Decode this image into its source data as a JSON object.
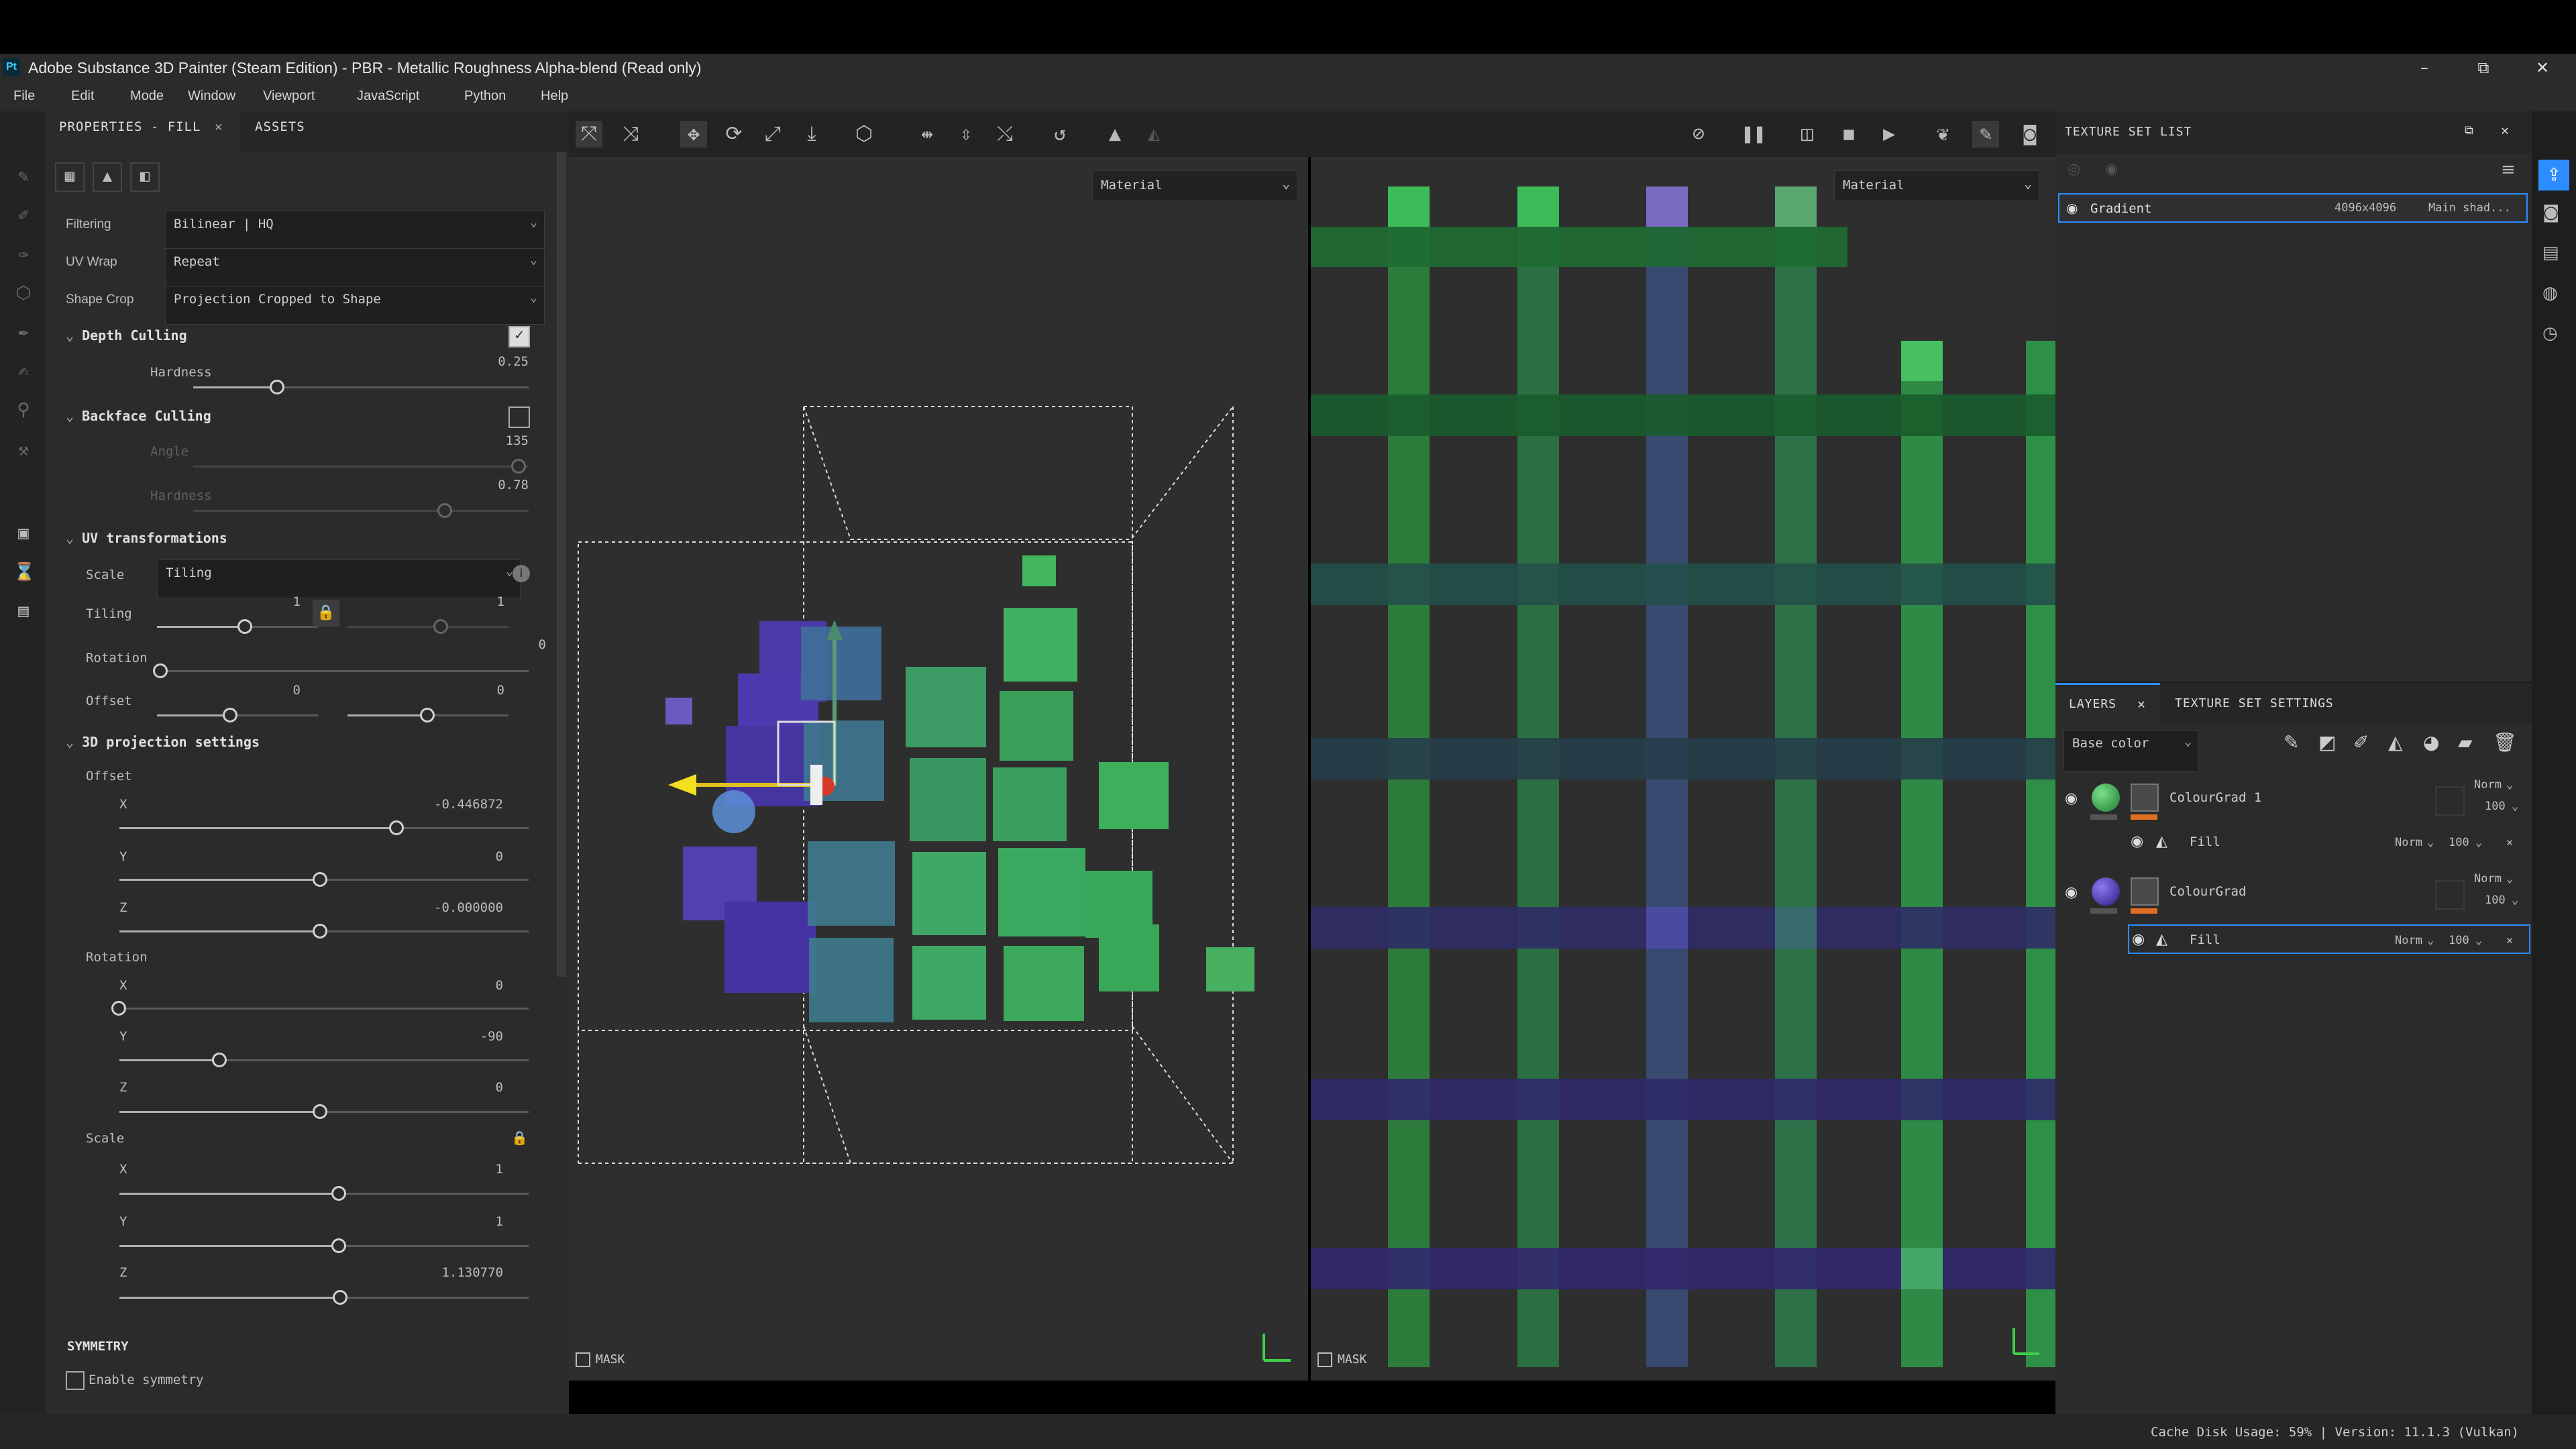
{
  "window": {
    "title": "Adobe Substance 3D Painter (Steam Edition) - PBR - Metallic Roughness Alpha-blend (Read only)",
    "app_icon": "Pt",
    "minimize": "–",
    "maximize": "⧉",
    "close": "✕"
  },
  "menu": [
    "File",
    "Edit",
    "Mode",
    "Window",
    "Viewport",
    "JavaScript",
    "Python",
    "Help"
  ],
  "properties": {
    "tab_properties": "PROPERTIES - FILL",
    "tab_assets": "ASSETS",
    "filtering_label": "Filtering",
    "filtering_value": "Bilinear | HQ",
    "uvwrap_label": "UV Wrap",
    "uvwrap_value": "Repeat",
    "shapecrop_label": "Shape Crop",
    "shapecrop_value": "Projection Cropped to Shape",
    "depth_culling": "Depth Culling",
    "hardness_label": "Hardness",
    "hardness_value": "0.25",
    "backface_culling": "Backface Culling",
    "angle_label": "Angle",
    "angle_value": "135",
    "bf_hardness_label": "Hardness",
    "bf_hardness_value": "0.78",
    "uv_transformations": "UV transformations",
    "scale_label": "Scale",
    "scale_value": "Tiling",
    "tiling_label": "Tiling",
    "tiling_value": "1",
    "tiling_value2": "1",
    "rotation_label": "Rotation",
    "rotation_value": "0",
    "offset_label": "Offset",
    "offset_value1": "0",
    "offset_value2": "0",
    "proj_settings": "3D projection settings",
    "proj_offset": "Offset",
    "x": "X",
    "y": "Y",
    "z": "Z",
    "offset_x": "-0.446872",
    "offset_y": "0",
    "offset_z": "-0.000000",
    "proj_rotation": "Rotation",
    "rot_x": "0",
    "rot_y": "-90",
    "rot_z": "0",
    "proj_scale": "Scale",
    "scale_x": "1",
    "scale_y": "1",
    "scale_z": "1.130770",
    "symmetry": "SYMMETRY",
    "enable_symmetry": "Enable symmetry"
  },
  "viewport": {
    "material_left": "Material",
    "material_right": "Material",
    "mask_left": "MASK",
    "mask_right": "MASK"
  },
  "texture_set_list": {
    "title": "TEXTURE SET LIST",
    "set_name": "Gradient",
    "set_size": "4096x4096",
    "set_shader": "Main shad..."
  },
  "layers": {
    "tab_layers": "LAYERS",
    "tab_tss": "TEXTURE SET SETTINGS",
    "channel": "Base color",
    "items": [
      {
        "name": "ColourGrad 1",
        "blend": "Norm",
        "opacity": "100"
      },
      {
        "name": "Fill",
        "blend": "Norm",
        "opacity": "100"
      },
      {
        "name": "ColourGrad",
        "blend": "Norm",
        "opacity": "100"
      },
      {
        "name": "Fill",
        "blend": "Norm",
        "opacity": "100"
      }
    ]
  },
  "status": {
    "text": "Cache Disk Usage:   59% | Version: 11.1.3 (Vulkan)"
  },
  "colors": {
    "accent_blue": "#2d8cff",
    "orange": "#e07020",
    "green": "#3db25a",
    "purple": "#5b3fb0"
  }
}
